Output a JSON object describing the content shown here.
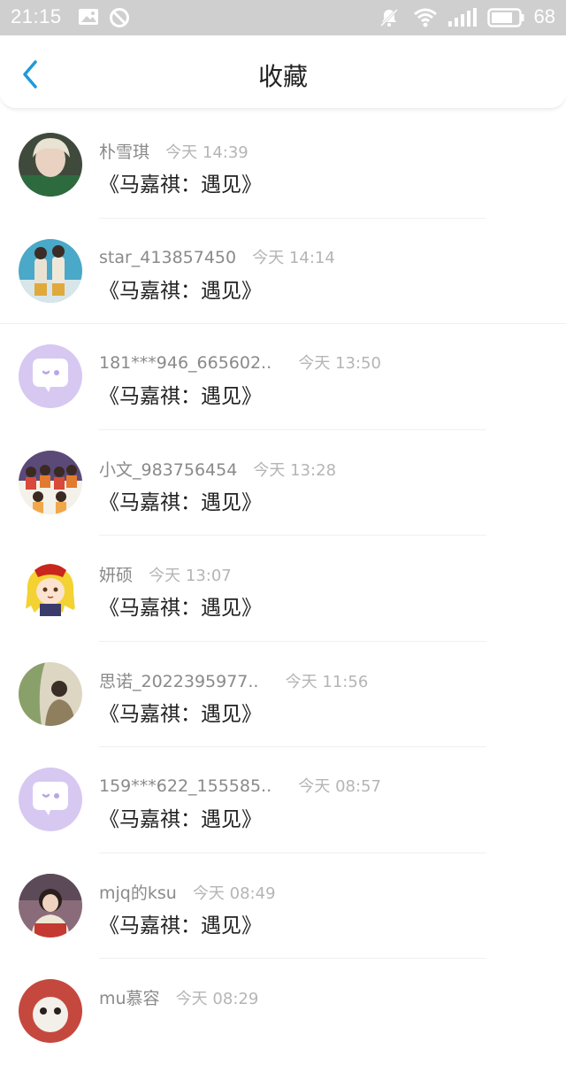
{
  "status_bar": {
    "time": "21:15",
    "battery": "68",
    "icons": [
      "image-icon",
      "block-icon",
      "mute-icon",
      "wifi-icon",
      "signal-icon",
      "battery-icon"
    ]
  },
  "header": {
    "title": "收藏",
    "back_icon": "chevron-left-icon"
  },
  "colors": {
    "accent": "#1e9bd7",
    "status_bar_bg": "#cfcfcf",
    "placeholder_avatar": "#d7c8f2"
  },
  "favorites": [
    {
      "user": "朴雪琪",
      "time": "今天 14:39",
      "title": "《马嘉祺：遇见》",
      "avatar": "photo"
    },
    {
      "user": "star_413857450",
      "time": "今天 14:14",
      "title": "《马嘉祺：遇见》",
      "avatar": "photo"
    },
    {
      "user": "181***946_665602..",
      "time": "今天 13:50",
      "title": "《马嘉祺：遇见》",
      "avatar": "default-chat-icon"
    },
    {
      "user": "小文_983756454",
      "time": "今天 13:28",
      "title": "《马嘉祺：遇见》",
      "avatar": "photo"
    },
    {
      "user": "妍硕",
      "time": "今天 13:07",
      "title": "《马嘉祺：遇见》",
      "avatar": "cartoon"
    },
    {
      "user": "思诺_2022395977..",
      "time": "今天 11:56",
      "title": "《马嘉祺：遇见》",
      "avatar": "photo"
    },
    {
      "user": "159***622_155585..",
      "time": "今天 08:57",
      "title": "《马嘉祺：遇见》",
      "avatar": "default-chat-icon"
    },
    {
      "user": "mjq的ksu",
      "time": "今天 08:49",
      "title": "《马嘉祺：遇见》",
      "avatar": "photo"
    },
    {
      "user": "mu慕容",
      "time": "今天 08:29",
      "title": "",
      "avatar": "photo"
    }
  ]
}
